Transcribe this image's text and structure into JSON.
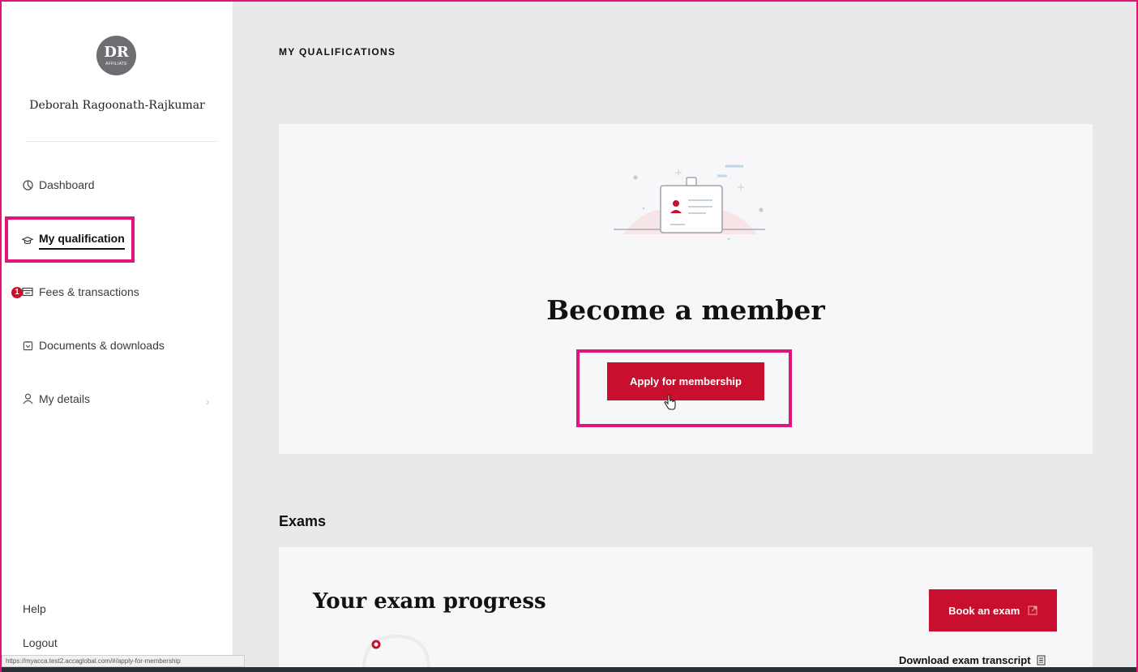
{
  "user": {
    "initials": "DR",
    "tier": "AFFILIATE",
    "name": "Deborah Ragoonath-Rajkumar"
  },
  "sidebar": {
    "items": [
      {
        "label": "Dashboard",
        "icon": "clock-pie-icon"
      },
      {
        "label": "My qualification",
        "icon": "graduation-cap-icon",
        "active": true
      },
      {
        "label": "Fees & transactions",
        "icon": "card-icon",
        "badge": "1"
      },
      {
        "label": "Documents & downloads",
        "icon": "document-box-icon"
      },
      {
        "label": "My details",
        "icon": "person-icon"
      }
    ],
    "help": "Help",
    "logout": "Logout"
  },
  "status_bar_url": "https://myacca.test2.accaglobal.com/#/apply-for-membership",
  "main": {
    "page_title": "MY QUALIFICATIONS",
    "membership_card": {
      "title": "Become a member",
      "button": "Apply for membership"
    },
    "exams": {
      "heading": "Exams",
      "progress_title": "Your exam progress",
      "book_button": "Book an exam",
      "transcript_link": "Download exam transcript"
    }
  },
  "colors": {
    "accent_red": "#c8102e",
    "highlight_pink": "#e0157a",
    "main_bg": "#e9e8ea"
  }
}
